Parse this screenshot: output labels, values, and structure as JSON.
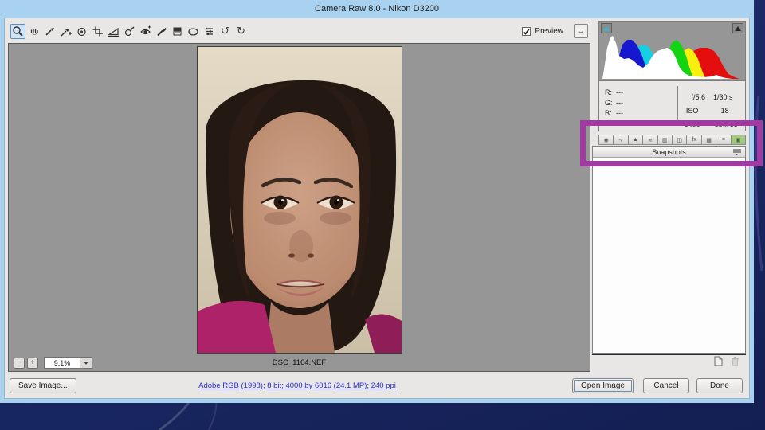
{
  "window": {
    "title": "Camera Raw 8.0  -  Nikon D3200"
  },
  "toolbar": {
    "tools": [
      "zoom",
      "hand",
      "white-balance",
      "color-sampler",
      "targeted-adjustment",
      "crop",
      "straighten",
      "spot-removal",
      "red-eye",
      "adjustment-brush",
      "graduated-filter",
      "radial-filter",
      "preferences",
      "rotate-left",
      "rotate-right"
    ],
    "active_tool": "zoom",
    "rotate_left_glyph": "↺",
    "rotate_right_glyph": "↻",
    "fullscreen_glyph": "↔",
    "preview": {
      "label": "Preview",
      "checked": true
    }
  },
  "histogram": {
    "channel_colors": {
      "white": "#ffffff",
      "red": "#e40e0e",
      "green": "#12d412",
      "blue": "#1717cf",
      "cyan": "#17cfe3",
      "magenta": "#dc14dc",
      "yellow": "#f7ef0e"
    },
    "shadow_clip_color": "#36b9c9",
    "highlight_clip_color": "#262626"
  },
  "exif": {
    "r_label": "R:",
    "g_label": "G:",
    "b_label": "B:",
    "r_value": "---",
    "g_value": "---",
    "b_value": "---",
    "aperture": "f/5.6",
    "shutter": "1/30 s",
    "iso": "ISO 6400",
    "lens": "18-55@55 mm"
  },
  "panel": {
    "tabs": [
      "basic",
      "tone-curve",
      "detail",
      "hsl-grayscale",
      "split-toning",
      "lens-corrections",
      "effects",
      "camera-calibration",
      "presets",
      "snapshots"
    ],
    "active_tab": "snapshots",
    "snapshots_title": "Snapshots"
  },
  "statusbar": {
    "zoom_out": "−",
    "zoom_in": "+",
    "zoom_level": "9.1%",
    "filename": "DSC_1164.NEF"
  },
  "footer": {
    "save_button": "Save Image...",
    "workflow_link": "Adobe RGB (1998); 8 bit; 4000 by 6016 (24.1 MP); 240 ppi",
    "open_button": "Open Image",
    "cancel_button": "Cancel",
    "done_button": "Done"
  },
  "annotation": {
    "highlight_color": "#a23aa4"
  }
}
